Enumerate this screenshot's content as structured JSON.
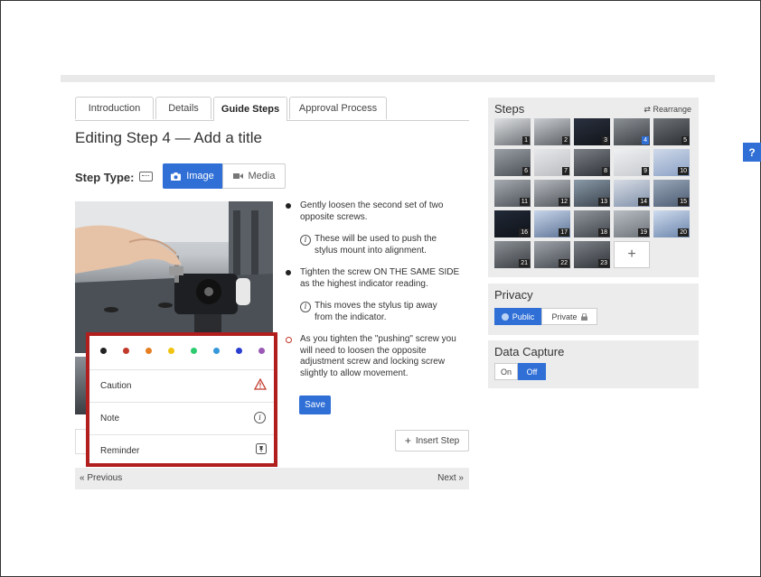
{
  "tabs": [
    {
      "label": "Introduction"
    },
    {
      "label": "Details"
    },
    {
      "label": "Guide Steps"
    },
    {
      "label": "Approval Process"
    }
  ],
  "editor": {
    "title": "Editing Step 4 — Add a title",
    "step_type_label": "Step Type:",
    "image_button": "Image",
    "media_button": "Media",
    "save_label": "Save",
    "insert_step_label": "Insert Step",
    "prev_label": "« Previous",
    "next_label": "Next »"
  },
  "bullets": [
    {
      "kind": "black",
      "text": "Gently loosen the second set of two opposite screws."
    },
    {
      "kind": "info",
      "text": "These will be used to push the stylus mount into alignment."
    },
    {
      "kind": "black",
      "text": "Tighten the screw ON THE SAME SIDE as the highest indicator reading."
    },
    {
      "kind": "info",
      "text": "This moves the stylus tip away from the indicator."
    },
    {
      "kind": "ring",
      "text": "As you tighten the \"pushing\" screw you will need to loosen the opposite adjustment screw and locking screw slightly to allow movement."
    }
  ],
  "bullet_popup": {
    "colors": [
      "#222222",
      "#c0392b",
      "#e67e22",
      "#f1c40f",
      "#2ecc71",
      "#3498db",
      "#2a3fd1",
      "#9b59b6"
    ],
    "options": [
      {
        "label": "Caution",
        "icon": "warning-triangle-icon"
      },
      {
        "label": "Note",
        "icon": "info-circle-icon"
      },
      {
        "label": "Reminder",
        "icon": "pin-icon"
      }
    ]
  },
  "steps_panel": {
    "title": "Steps",
    "rearrange_label": "Rearrange",
    "thumbnails": [
      "1",
      "2",
      "3",
      "4",
      "5",
      "6",
      "7",
      "8",
      "9",
      "10",
      "11",
      "12",
      "13",
      "14",
      "15",
      "16",
      "17",
      "18",
      "19",
      "20",
      "21",
      "22",
      "23"
    ],
    "selected": "4",
    "add_label": "+"
  },
  "privacy": {
    "title": "Privacy",
    "public_label": "Public",
    "private_label": "Private"
  },
  "data_capture": {
    "title": "Data Capture",
    "on_label": "On",
    "off_label": "Off"
  },
  "help": {
    "label": "?"
  },
  "colors": {
    "accent": "#2f6fd6",
    "highlight": "#b01e1e",
    "panel": "#ececec"
  }
}
